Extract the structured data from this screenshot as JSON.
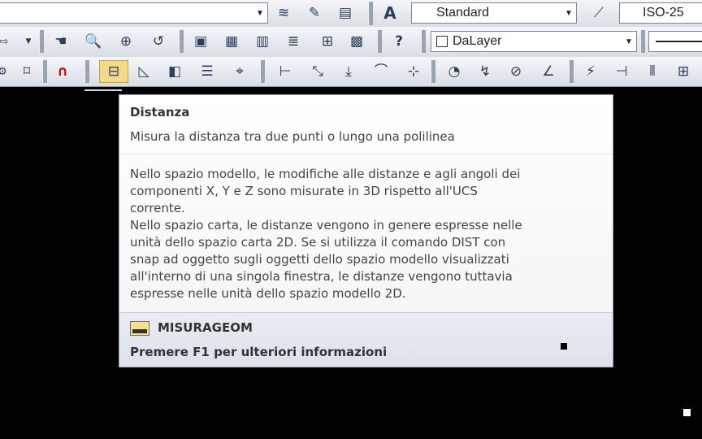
{
  "toolbar": {
    "text_style": "Standard",
    "dim_style": "ISO-25",
    "layer": "DaLayer"
  },
  "tooltip": {
    "title": "Distanza",
    "summary": "Misura la distanza tra due punti o lungo una polilinea",
    "body_lines": [
      "Nello spazio modello, le modifiche alle distanze e agli angoli dei",
      "componenti X, Y e Z sono misurate in 3D rispetto all'UCS",
      "corrente.",
      "Nello spazio carta, le distanze vengono in genere espresse nelle",
      "unità dello spazio carta 2D. Se si utilizza il comando DIST con",
      "snap ad oggetto sugli oggetti dello spazio modello visualizzati",
      "all'interno di una singola finestra, le distanze vengono tuttavia",
      "espresse nelle unità dello spazio modello 2D."
    ],
    "command": "MISURAGEOM",
    "help": "Premere F1 per ulteriori informazioni"
  },
  "icons": {
    "row1": [
      "dropdown-arrow-icon",
      "layer-states-icon",
      "text-style-icon",
      "multiline-text-icon",
      "annotation-text-icon",
      "dimension-style-icon"
    ],
    "row2": [
      "redo-icon",
      "pan-icon",
      "zoom-realtime-icon",
      "zoom-window-icon",
      "zoom-previous-icon",
      "properties-icon",
      "design-center-icon",
      "tool-palettes-icon",
      "sheet-set-icon",
      "markup-icon",
      "calculator-icon",
      "help-icon"
    ],
    "row3": [
      "snap-settings-icon",
      "object-snap-icon",
      "magnet-icon",
      "distance-icon",
      "area-icon",
      "region-mass-icon",
      "list-icon",
      "locate-point-icon",
      "linear-dimension-icon",
      "aligned-dimension-icon",
      "angular-icon",
      "arc-length-icon",
      "ordinate-icon",
      "radius-icon",
      "jogged-icon",
      "diameter-icon",
      "angle-icon",
      "quick-dimension-icon",
      "baseline-icon",
      "continue-icon",
      "tolerance-icon"
    ]
  }
}
